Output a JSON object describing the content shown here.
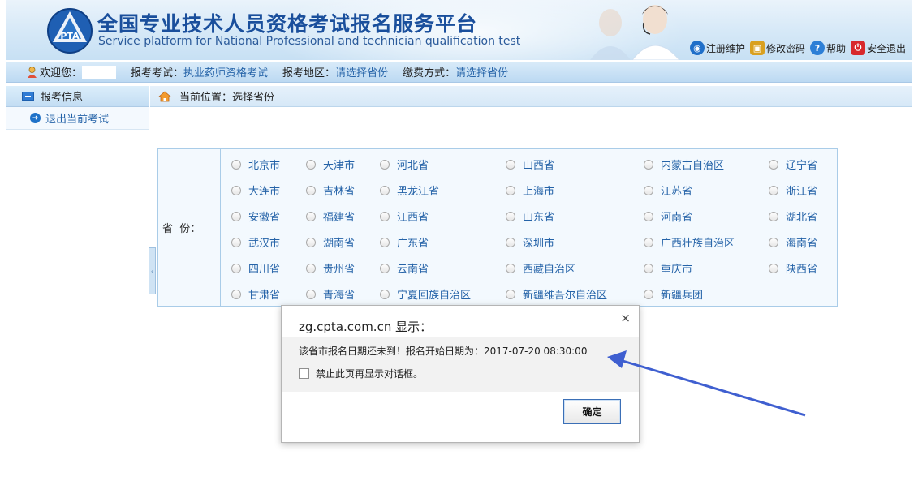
{
  "header": {
    "title_cn": "全国专业技术人员资格考试报名服务平台",
    "title_en": "Service platform for National Professional and technician qualification test",
    "logo_text": "PTA",
    "links": [
      {
        "label": "注册维护",
        "icon": "globe-icon",
        "color": "#1f6fc9"
      },
      {
        "label": "修改密码",
        "icon": "lock-icon",
        "color": "#d9a020"
      },
      {
        "label": "帮助",
        "icon": "help-icon",
        "color": "#2d7fd6"
      },
      {
        "label": "安全退出",
        "icon": "power-icon",
        "color": "#d8282c"
      }
    ]
  },
  "infobar": {
    "welcome_label": "欢迎您：",
    "exam_label": "报考考试：",
    "exam_value": "执业药师资格考试",
    "region_label": "报考地区：",
    "region_value": "请选择省份",
    "pay_label": "缴费方式：",
    "pay_value": "请选择省份"
  },
  "sidebar": {
    "heading": "报考信息",
    "items": [
      {
        "label": "退出当前考试"
      }
    ]
  },
  "location": {
    "text": "当前位置：选择省份"
  },
  "province_table": {
    "label": "省  份：",
    "provinces": [
      "北京市",
      "天津市",
      "河北省",
      "山西省",
      "内蒙古自治区",
      "辽宁省",
      "大连市",
      "吉林省",
      "黑龙江省",
      "上海市",
      "江苏省",
      "浙江省",
      "安徽省",
      "福建省",
      "江西省",
      "山东省",
      "河南省",
      "湖北省",
      "武汉市",
      "湖南省",
      "广东省",
      "深圳市",
      "广西壮族自治区",
      "海南省",
      "四川省",
      "贵州省",
      "云南省",
      "西藏自治区",
      "重庆市",
      "陕西省",
      "甘肃省",
      "青海省",
      "宁夏回族自治区",
      "新疆维吾尔自治区",
      "新疆兵团"
    ]
  },
  "dialog": {
    "title": "zg.cpta.com.cn 显示：",
    "message": "该省市报名日期还未到！报名开始日期为：2017-07-20 08:30:00",
    "checkbox_label": "禁止此页再显示对话框。",
    "ok_label": "确定",
    "close_glyph": "×"
  },
  "colors": {
    "accent": "#2563a8",
    "annotation_arrow": "#3f5fd0"
  }
}
